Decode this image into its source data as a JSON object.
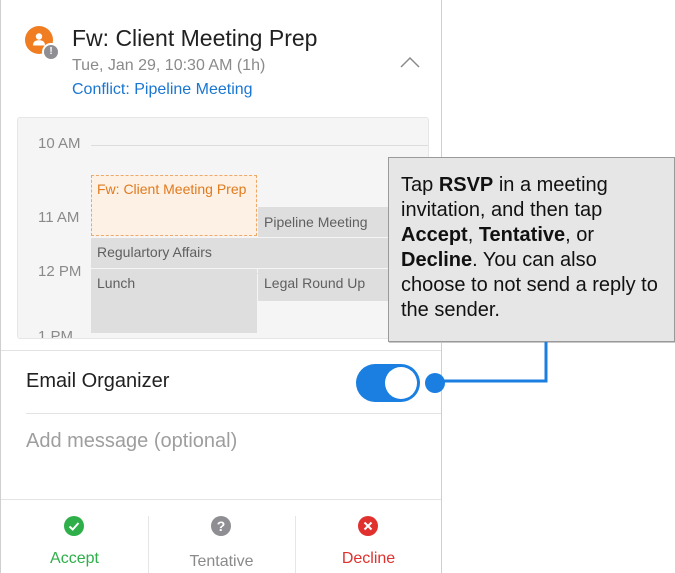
{
  "event": {
    "title": "Fw: Client Meeting Prep",
    "time": "Tue, Jan 29, 10:30 AM (1h)",
    "conflict": "Conflict: Pipeline Meeting",
    "badge": "!"
  },
  "calendar": {
    "hours": [
      "10 AM",
      "11 AM",
      "12 PM",
      "1 PM"
    ],
    "events": [
      {
        "label": "Fw: Client Meeting Prep"
      },
      {
        "label": "Pipeline Meeting"
      },
      {
        "label": "Regulartory Affairs"
      },
      {
        "label": "Lunch"
      },
      {
        "label": "Legal Round Up"
      }
    ]
  },
  "email_organizer": {
    "label": "Email Organizer",
    "enabled": true
  },
  "message": {
    "placeholder": "Add message (optional)"
  },
  "actions": {
    "accept": "Accept",
    "tentative": "Tentative",
    "decline": "Decline",
    "tentative_glyph": "?"
  },
  "callout": {
    "p1": "Tap ",
    "rsvp": "RSVP",
    "p2": " in a meeting invitation, and then tap ",
    "accept": "Accept",
    "p3": ", ",
    "tentative": "Tentative",
    "p4": ", or ",
    "decline": "Decline",
    "p5": ". You can also choose to not send a reply to the sender."
  },
  "colors": {
    "accent_blue": "#1a7fe0",
    "accept_green": "#2eaf4a",
    "decline_red": "#e0312e",
    "tentative_gray": "#8e8e93",
    "organizer_orange": "#f07d22"
  }
}
